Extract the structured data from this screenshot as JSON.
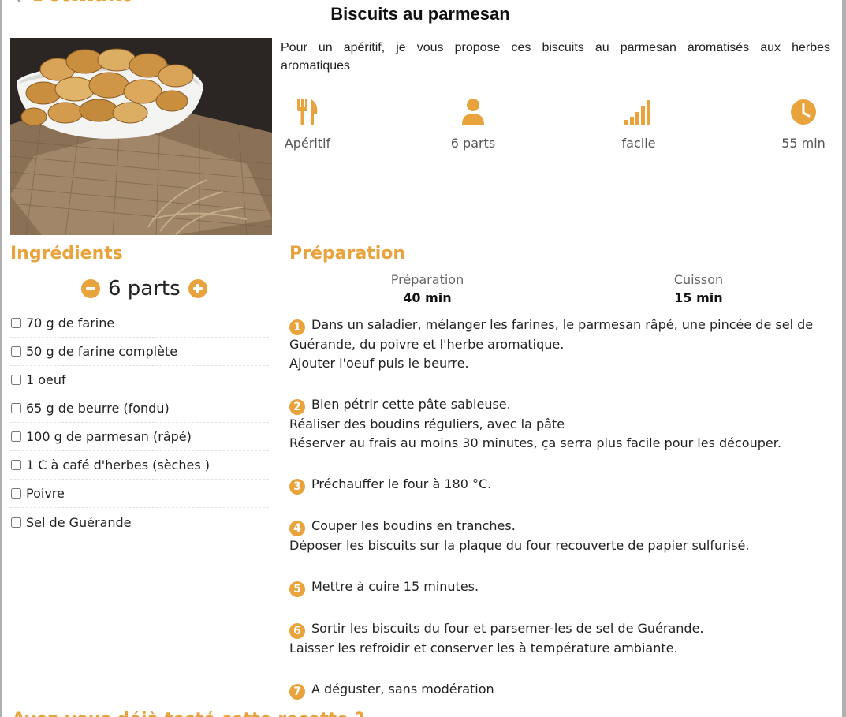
{
  "header": {
    "logo_text": "Pétillant",
    "title": "Biscuits au parmesan"
  },
  "photo": {
    "icon": "biscuits-in-white-bowl-photo"
  },
  "intro": "Pour un apéritif, je vous propose ces biscuits au parmesan aromatisés aux herbes aromatiques",
  "meta": [
    {
      "icon": "fork-knife-icon",
      "label": "Apéritif"
    },
    {
      "icon": "person-icon",
      "label": "6 parts"
    },
    {
      "icon": "signal-bars-icon",
      "label": "facile"
    },
    {
      "icon": "clock-icon",
      "label": "55 min"
    }
  ],
  "ingredients": {
    "heading": "Ingrédients",
    "servings": "6 parts",
    "items": [
      "70 g de farine",
      "50 g de farine complète",
      "1 oeuf",
      "65 g de beurre (fondu)",
      "100 g de parmesan (râpé)",
      "1 C à café d'herbes (sèches )",
      "Poivre",
      "Sel de Guérande"
    ]
  },
  "preparation": {
    "heading": "Préparation",
    "prep_label": "Préparation",
    "prep_value": "40 min",
    "cook_label": "Cuisson",
    "cook_value": "15 min",
    "steps": [
      {
        "n": "1",
        "lines": [
          "Dans un saladier, mélanger les farines, le parmesan râpé, une pincée de sel de",
          "Guérande, du poivre et l'herbe aromatique.",
          "Ajouter l'oeuf puis le beurre."
        ]
      },
      {
        "n": "2",
        "lines": [
          "Bien pétrir cette pâte sableuse.",
          "Réaliser des boudins réguliers, avec la pâte",
          "Réserver au frais au moins 30 minutes, ça serra plus facile pour les découper."
        ]
      },
      {
        "n": "3",
        "lines": [
          "Préchauffer le four à 180 °C."
        ]
      },
      {
        "n": "4",
        "lines": [
          "Couper les boudins en tranches.",
          "Déposer les biscuits sur la plaque du four recouverte de papier sulfurisé."
        ]
      },
      {
        "n": "5",
        "lines": [
          "Mettre à cuire 15 minutes."
        ]
      },
      {
        "n": "6",
        "lines": [
          "Sortir les biscuits du four et parsemer-les de sel de Guérande.",
          "Laisser les refroidir et conserver les à température ambiante."
        ]
      },
      {
        "n": "7",
        "lines": [
          "A déguster, sans modération"
        ]
      }
    ]
  },
  "next_section": {
    "heading": "Avez-vous déjà testé cette recette ?"
  },
  "colors": {
    "accent": "#e8a33c",
    "text": "#222222",
    "muted": "#666666"
  }
}
